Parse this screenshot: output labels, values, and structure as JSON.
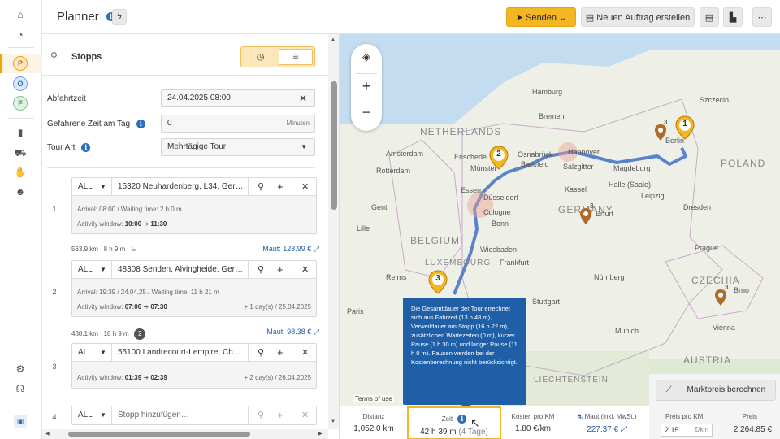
{
  "app": {
    "title": "Planner",
    "send_label": "Senden",
    "new_order_label": "Neuen Auftrag erstellen",
    "rail_letters": [
      "P",
      "O",
      "F"
    ]
  },
  "left": {
    "section_title": "Stopps",
    "departure_label": "Abfahrtzeit",
    "departure_value": "24.04.2025 08:00",
    "driven_label": "Gefahrene Zeit am Tag",
    "driven_value": "0",
    "driven_unit": "Minuten",
    "tour_type_label": "Tour Art",
    "tour_type_value": "Mehrtägige Tour",
    "stops": [
      {
        "num": "1",
        "filter": "ALL",
        "address": "15320 Neuhardenberg, L34, Ger…",
        "arrival": "Arrival: 08:00 / Waiting time: 2 h 0 m",
        "window_label": "Activity window:",
        "from": "10:00",
        "to": "11:30",
        "extra": ""
      },
      {
        "num": "2",
        "filter": "ALL",
        "address": "48308 Senden, Alvingheide, Ger…",
        "arrival": "Arrival: 19:39 / 24.04.25 / Waiting time: 11 h 21 m",
        "window_label": "Activity window:",
        "from": "07:00",
        "to": "07:30",
        "extra": "+ 1 day(s) / 25.04.2025"
      },
      {
        "num": "3",
        "filter": "ALL",
        "address": "55100 Landrecourt-Lempire, Ch…",
        "arrival": "",
        "window_label": "Activity window:",
        "from": "01:39",
        "to": "02:39",
        "extra": "+ 2 day(s) / 26.04.2025"
      },
      {
        "num": "4",
        "filter": "ALL",
        "address": "Stopp hinzufügen…",
        "arrival": "",
        "window_label": "",
        "from": "",
        "to": "",
        "extra": ""
      }
    ],
    "legs": [
      {
        "dist": "563.9 km",
        "time": "8 h 9 m",
        "maut": "Maut: 128.99 €"
      },
      {
        "dist": "488.1 km",
        "time": "18 h 9 m",
        "badge": "2",
        "maut": "Maut: 98.38 €"
      }
    ]
  },
  "map": {
    "terms": "Terms of use",
    "countries": [
      "NETHERLANDS",
      "BELGIUM",
      "LUXEMBOURG",
      "GERMANY",
      "CZECHIA",
      "AUSTRIA",
      "LIECHTENSTEIN",
      "POLAND"
    ],
    "cities": [
      "Hamburg",
      "Szczecin",
      "Bremen",
      "Berlin",
      "Amsterdam",
      "Enschede",
      "Osnabrück",
      "Rotterdam",
      "Münster",
      "Bielefeld",
      "Hannover",
      "Salzgitter",
      "Magdeburg",
      "Leipzig",
      "Dresden",
      "Essen",
      "Düsseldorf",
      "Cologne",
      "Bonn",
      "Kassel",
      "Gent",
      "Lille",
      "Wiesbaden",
      "Frankfurt",
      "Prague",
      "Paris",
      "Nürnberg",
      "Munich",
      "Vienna",
      "Brno",
      "Reims",
      "Stuttgart",
      "Halle (Saale)",
      "Erfurt"
    ],
    "pins": [
      "1",
      "2",
      "3",
      "3",
      "3",
      "3"
    ]
  },
  "tooltip": {
    "text": "Die Gesamtdauer der Tour errechnet sich aus Fahrzeit (13 h 48 m), Verweildauer am Stopp (16 h 22 m), zusätzlichen Wartezeiten (0 m), kurzer Pause (1 h 30 m) und langer Pause (11 h 0 m). Pausen werden bei der Kostenberechnung nicht berücksichtigt."
  },
  "summary": {
    "market_price_label": "Marktpreis berechnen",
    "distance_label": "Distanz",
    "distance_value": "1,052.0 km",
    "time_label": "Zeit",
    "time_value": "42 h 39 m",
    "time_days": "(4 Tage)",
    "cost_km_label": "Kosten pro KM",
    "cost_km_value": "1.80 €/km",
    "toll_label": "Maut (inkl. MwSt.)",
    "toll_value": "227.37 €",
    "price_km_label": "Preis pro KM",
    "price_km_value": "2.15",
    "price_km_unit": "€/km",
    "price_label": "Preis",
    "price_value": "2,264.85 €"
  },
  "colors": {
    "accent": "#f5b623",
    "route": "#4a76c9",
    "tooltip": "#1f5fa8"
  }
}
